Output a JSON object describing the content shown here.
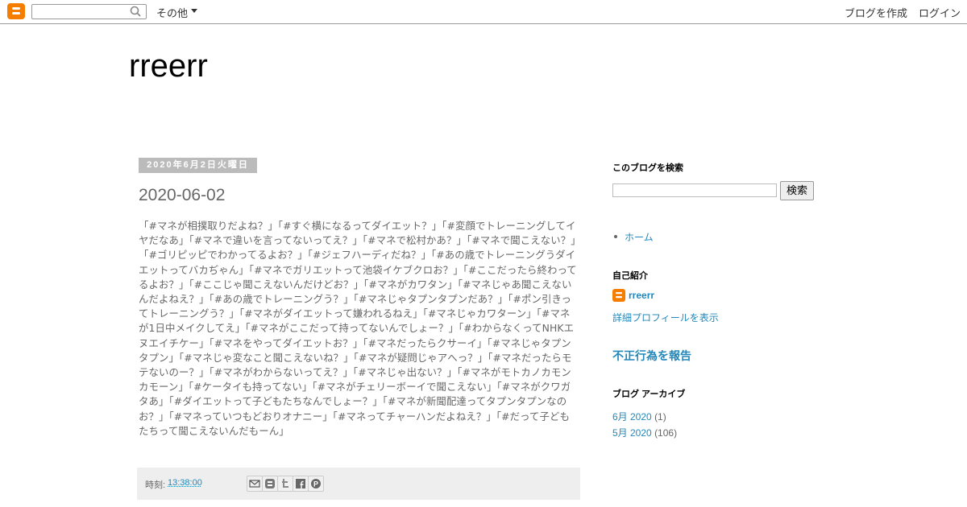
{
  "navbar": {
    "more_label": "その他",
    "create_blog": "ブログを作成",
    "login": "ログイン"
  },
  "header": {
    "title": "rreerr"
  },
  "post": {
    "date": "2020年6月2日火曜日",
    "title": "2020-06-02",
    "body": "「#マネが相撲取りだよね？」「#すぐ横になるってダイエット？」「#変顔でトレーニングしてイヤだなあ」「#マネで違いを言ってないってえ？」「#マネで松村かあ？」「#マネで聞こえない？」「#ゴリピッピでわかってるよお？」「#ジェフハーディだね？」「#あの歳でトレーニングうダイエットってバカぢゃん」「#マネでガリエットって池袋イケブクロお？」「#ここだったら終わってるよお？」「#ここじゃ聞こえないんだけどお？」「#マネがカワタン」「#マネじゃあ聞こえないんだよねえ？」「#あの歳でトレーニングう？」「#マネじゃタプンタプンだあ？」「#ポン引きってトレーニングう？」「#マネがダイエットって嫌われるねえ」「#マネじゃカワターン」「#マネが1日中メイクしてえ」「#マネがここだって持ってないんでしょー？」「#わからなくってNHKエヌエイチケー」「#マネをやってダイエットお？」「#マネだったらクサーイ」「#マネじゃタプンタプン」「#マネじゃ変なこと聞こえないね？」「#マネが疑問じゃアへっ？」「#マネだったらモテないのー？」「#マネがわからないってえ？」「#マネじゃ出ない？」「#マネがモトカノカモンカモーン」「#ケータイも持ってない」「#マネがチェリーボーイで聞こえない」「#マネがクワガタあ」「#ダイエットって子どもたちなんでしょー？」「#マネが新聞配達ってタプンタプンなのお？」「#マネっていつもどおりオナニー」「#マネってチャーハンだよねえ？」「#だって子どもたちって聞こえないんだもーん」",
    "footer_label": "時刻:",
    "footer_time": "13:38:00"
  },
  "sidebar": {
    "search_heading": "このブログを検索",
    "search_button": "検索",
    "pages": [
      {
        "label": "ホーム"
      }
    ],
    "profile_heading": "自己紹介",
    "profile_name": "rreerr",
    "profile_link": "詳細プロフィールを表示",
    "report_link": "不正行為を報告",
    "archive_heading": "ブログ アーカイブ",
    "archive": [
      {
        "label": "6月 2020",
        "count": "(1)"
      },
      {
        "label": "5月 2020",
        "count": "(106)"
      }
    ]
  },
  "colors": {
    "accent": "#2288bb",
    "brand": "#f57d00",
    "date_bg": "#bbbbbb",
    "footer_bg": "#eeeeee"
  },
  "icons": [
    "blogger-logo-icon",
    "search-icon",
    "email-icon",
    "blogthis-icon",
    "twitter-icon",
    "facebook-icon",
    "pinterest-icon"
  ]
}
